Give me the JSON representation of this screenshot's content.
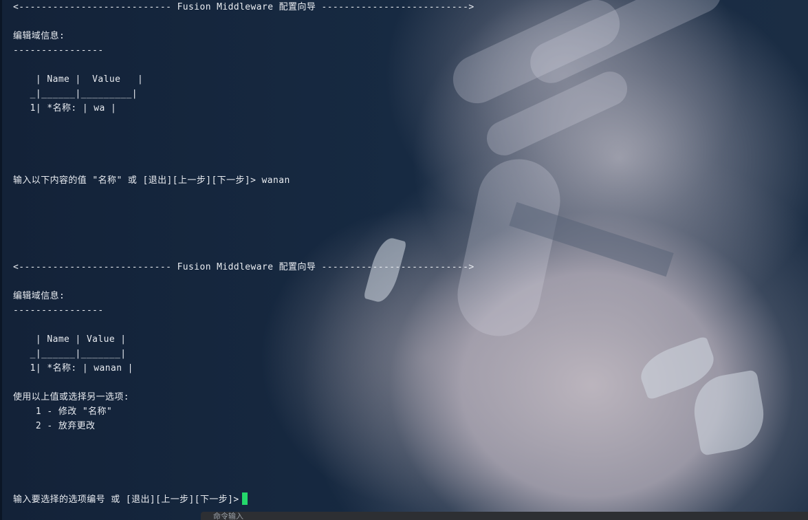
{
  "terminal": {
    "lines": [
      "<--------------------------- Fusion Middleware 配置向导 -------------------------->",
      "编辑域信息:",
      "----------------",
      "    | Name |  Value   |",
      "   _|______|_________|",
      "   1| *名称: | wa |",
      "输入以下内容的值 \"名称\" 或 [退出][上一步][下一步]> wanan",
      "<--------------------------- Fusion Middleware 配置向导 -------------------------->",
      "编辑域信息:",
      "----------------",
      "    | Name | Value |",
      "   _|______|_______|",
      "   1| *名称: | wanan |",
      "使用以上值或选择另一选项:",
      "    1 - 修改 \"名称\"",
      "    2 - 放弃更改",
      "输入要选择的选项编号 或 [退出][上一步][下一步]>"
    ]
  },
  "input_bar": {
    "hint": "命令输入"
  },
  "colors": {
    "text": "#e9ecf1",
    "cursor": "#24d86b",
    "background": "#14243a"
  }
}
